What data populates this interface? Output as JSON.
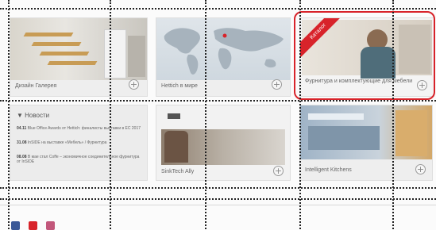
{
  "tiles": {
    "design_gallery": {
      "caption": "Дизайн Галерея"
    },
    "world_map": {
      "caption": "Hettich в мире"
    },
    "catalog": {
      "ribbon": "Каталог",
      "caption": "Фурнитура и комплектующие для мебели"
    },
    "news": {
      "title": "Новости",
      "items": [
        {
          "date": "04.11",
          "text": "Blue Office Awards от Hettich: финалисты выставки в ЕС 2017"
        },
        {
          "date": "31.08",
          "text": "InSIDE на выставке «Мебель» / Фурнитура"
        },
        {
          "date": "08.08",
          "text": "В мае стал Coffe – экономичное соединительное фурнитура от InSIDE"
        }
      ]
    },
    "sinktech": {
      "caption": "SinkTech Ally"
    },
    "kitchens": {
      "caption": "Intelligent Kitchens"
    }
  },
  "expand_symbol": "+",
  "colors": {
    "highlight": "#d8232a",
    "facebook": "#3b5998",
    "youtube": "#d8232a",
    "instagram": "#c2577b"
  },
  "social": [
    "facebook-icon",
    "youtube-icon",
    "instagram-icon"
  ]
}
